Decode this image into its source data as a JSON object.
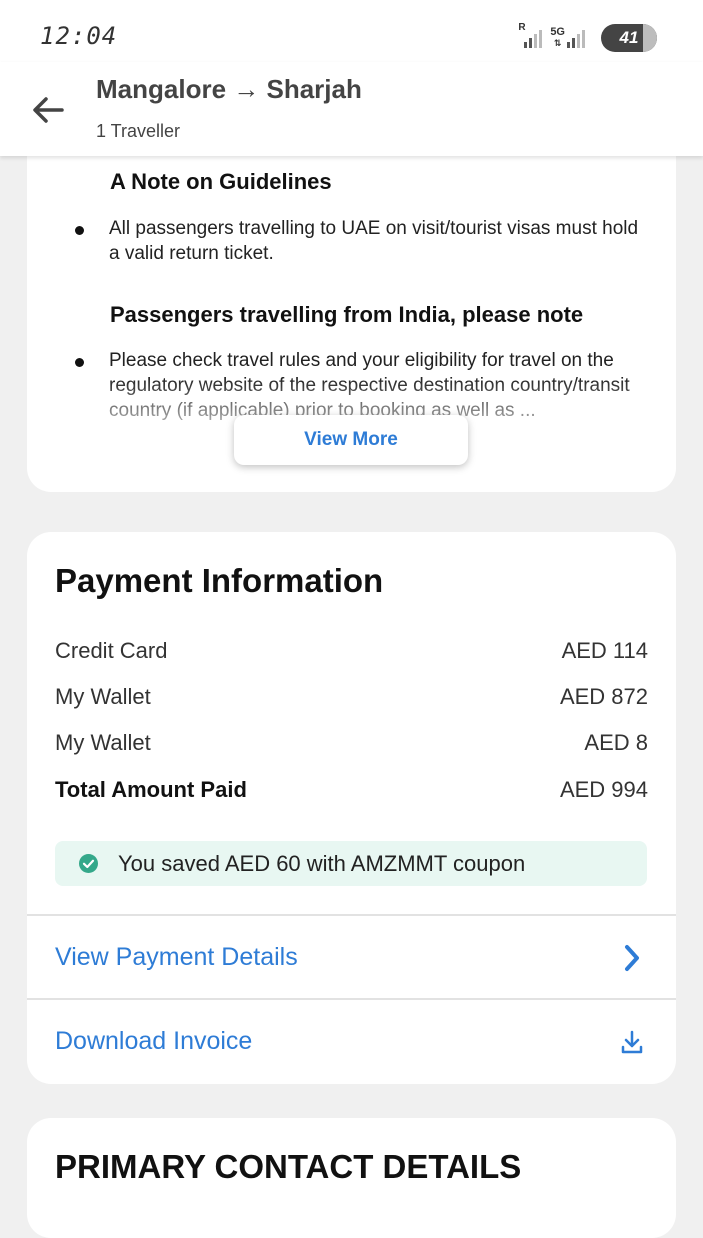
{
  "status": {
    "time": "12:04",
    "battery": "41",
    "network": "5G"
  },
  "header": {
    "title": "Mangalore → Sharjah",
    "subtitle": "1 Traveller"
  },
  "guidelines": {
    "heading1": "A Note on Guidelines",
    "item1": "All passengers travelling to UAE on visit/tourist visas must hold a valid return ticket.",
    "heading2": "Passengers travelling from India, please note",
    "item2": "Please check travel rules and your eligibility for travel on the regulatory website of the respective destination country/transit country (if applicable) prior to booking as well as ...",
    "view_more": "View More"
  },
  "payment": {
    "title": "Payment Information",
    "rows": [
      {
        "label": "Credit Card",
        "value": "AED 114"
      },
      {
        "label": "My Wallet",
        "value": "AED 872"
      },
      {
        "label": "My Wallet",
        "value": "AED 8"
      },
      {
        "label": "Total Amount Paid",
        "value": "AED 994"
      }
    ],
    "saved_text": "You saved AED 60 with AMZMMT coupon",
    "view_details": "View Payment Details",
    "download_invoice": "Download Invoice"
  },
  "contact": {
    "title": "PRIMARY CONTACT DETAILS"
  },
  "colors": {
    "link": "#2e7cd6",
    "saved_bg": "#e8f7f2",
    "check": "#34a88a"
  }
}
